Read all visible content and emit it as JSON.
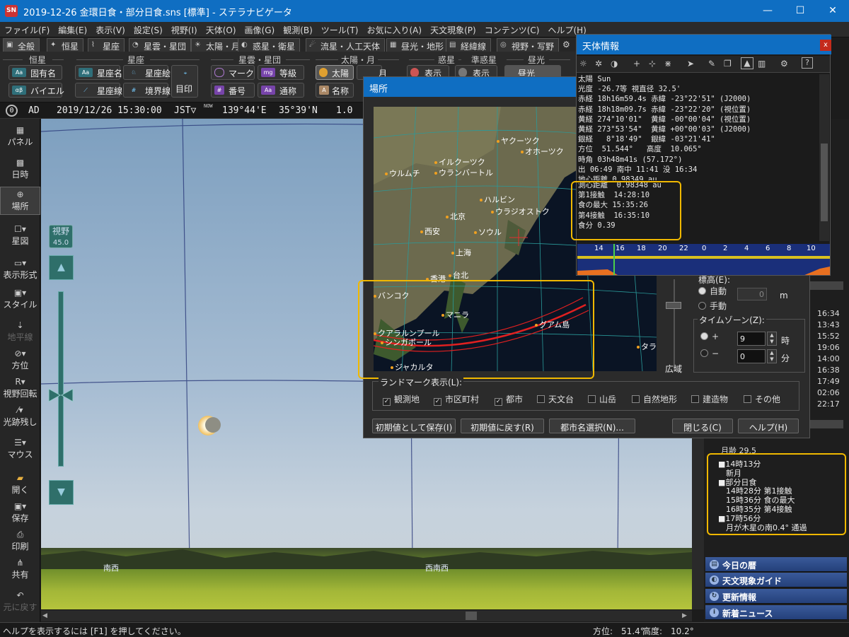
{
  "window": {
    "title": "2019-12-26 金環日食・部分日食.sns [標準] - ステラナビゲータ",
    "app_icon": "SN",
    "minimize": "—",
    "maximize": "☐",
    "close": "✕"
  },
  "menu": [
    "ファイル(F)",
    "編集(E)",
    "表示(V)",
    "設定(S)",
    "視野(I)",
    "天体(O)",
    "画像(G)",
    "観測(B)",
    "ツール(T)",
    "お気に入り(A)",
    "天文現象(P)",
    "コンテンツ(C)",
    "ヘルプ(H)"
  ],
  "tabs": [
    "全般",
    "恒星",
    "星座",
    "星雲・星団",
    "太陽・月",
    "惑星・衛星",
    "流星・人工天体",
    "昼光・地形",
    "経緯線",
    "視野・写野"
  ],
  "ribbon": {
    "groups": [
      "恒星",
      "星座",
      "星雲・星団",
      "太陽・月",
      "惑星",
      "準惑星",
      "昼光"
    ],
    "buttons": {
      "proper_name": "固有名",
      "bayer": "バイエル",
      "constellation_name": "星座名",
      "constellation_line": "星座線",
      "constellation_art": "星座絵",
      "boundary": "境界線",
      "seal": "目印",
      "mark": "マーク",
      "number": "番号",
      "magnitude": "等級",
      "common_name": "通称",
      "sun": "太陽",
      "moon": "月",
      "name": "名称",
      "show1": "表示",
      "show2": "表示",
      "daylight": "昼光"
    }
  },
  "status_row": {
    "era": "AD",
    "datetime": "2019/12/26 15:30:00",
    "tz": "JST▽",
    "now": "NOW",
    "longitude": "139°44'E",
    "latitude": "35°39'N",
    "zoom": "1.0"
  },
  "left_panel": [
    "パネル",
    "日時",
    "場所",
    "星図",
    "表示形式",
    "スタイル",
    "地平線",
    "方位",
    "視野回転",
    "光跡残し",
    "マウス",
    "開く",
    "保存",
    "印刷",
    "共有",
    "元に戻す"
  ],
  "fov": {
    "label": "視野",
    "value": "45.0"
  },
  "horizon_labels": [
    "南西",
    "西南西"
  ],
  "status_bar": {
    "help": "ヘルプを表示するには [F1] を押してください。",
    "azimuth": "方位:　51.4°",
    "altitude": "高度:　10.2°"
  },
  "place_dialog": {
    "title": "場所",
    "cities": [
      "ヤクーツク",
      "オホーツク",
      "イルクーツク",
      "ウランバートル",
      "ウルムチ",
      "ハルビン",
      "ウラジオストク",
      "北京",
      "西安",
      "ソウル",
      "上海",
      "香港",
      "台北",
      "バンコク",
      "マニラ",
      "グアム島",
      "クアラルンプール",
      "シンガポール",
      "ジャカルタ",
      "タラワ"
    ],
    "elev_label": "標高(E):",
    "auto": "自動",
    "manual": "手動",
    "elev_unit": "m",
    "elev_value": "0",
    "timezone_label": "タイムゾーン(Z):",
    "plus": "+",
    "minus": "−",
    "tz_hours": "9",
    "tz_minutes": "0",
    "hour_unit": "時",
    "min_unit": "分",
    "wide": "広域",
    "landmark_label": "ランドマーク表示(L):",
    "landmarks": [
      {
        "label": "観測地",
        "checked": true
      },
      {
        "label": "市区町村",
        "checked": true
      },
      {
        "label": "都市",
        "checked": true
      },
      {
        "label": "天文台",
        "checked": false
      },
      {
        "label": "山岳",
        "checked": false
      },
      {
        "label": "自然地形",
        "checked": false
      },
      {
        "label": "建造物",
        "checked": false
      },
      {
        "label": "その他",
        "checked": false
      }
    ],
    "buttons": {
      "save_default": "初期値として保存(I)",
      "reset_default": "初期値に戻す(R)",
      "city_select": "都市名選択(N)...",
      "close": "閉じる(C)",
      "help": "ヘルプ(H)"
    }
  },
  "info_window": {
    "title": "天体情報",
    "lines": [
      "太陽 Sun",
      "光度 -26.7等 視直径 32.5'",
      "赤経 18h16m59.4s 赤緯 -23°22'51\" (J2000)",
      "赤経 18h18m09.7s 赤緯 -23°22'20\" (視位置)",
      "黄経 274°10'01\"  黄緯 -00°00'04\" (視位置)",
      "黄経 273°53'54\"  黄緯 +00°00'03\" (J2000)",
      "銀経   8°18'49\"  銀緯 -03°21'41\"",
      "方位  51.544°   高度  10.065°",
      "時角 03h48m41s (57.172°)",
      "出 06:49 南中 11:41 没 16:34",
      "地心距離 0.98349 au",
      "測心距離  0.98348 au",
      "第1接触  14:28:10",
      "食の最大 15:35:26",
      "第4接触  16:35:10",
      "食分 0.39"
    ],
    "timeline_ticks": [
      "14",
      "16",
      "18",
      "20",
      "22",
      "0",
      "2",
      "4",
      "6",
      "8",
      "10"
    ]
  },
  "right_panel": {
    "times": [
      "16:34",
      "13:43",
      "15:52",
      "19:06",
      "14:00",
      "16:38",
      "17:49",
      "02:06",
      "22:17"
    ],
    "moon_age_line": "月齢 29.5",
    "calendar": [
      "■14時13分",
      "　新月",
      "■部分日食",
      "　14時28分 第1接触",
      "　15時36分 食の最大",
      "　16時35分 第4接触",
      "■17時56分",
      "　月が木星の南0.4° 通過"
    ],
    "nav": [
      "今日の暦",
      "天文現象ガイド",
      "更新情報",
      "新着ニュース"
    ]
  }
}
